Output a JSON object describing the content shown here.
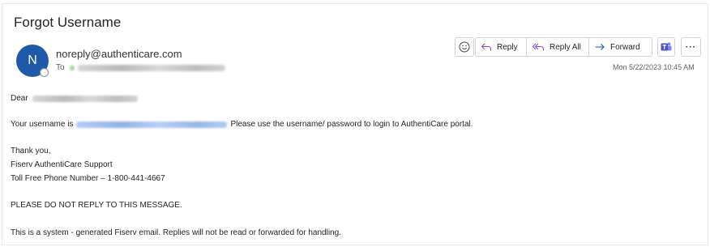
{
  "email": {
    "subject": "Forgot Username",
    "avatar_initial": "N",
    "sender": "noreply@authenticare.com",
    "to_label": "To",
    "date": "Mon 5/22/2023 10:45 AM"
  },
  "toolbar": {
    "emoji_icon": "smiley-icon",
    "reply_label": "Reply",
    "reply_all_label": "Reply All",
    "forward_label": "Forward",
    "teams_icon": "teams-icon",
    "more_label": "···"
  },
  "body": {
    "greeting": "Dear",
    "username_prefix": "Your username is",
    "username_suffix": "Please use the username/ password to login to AuthentiCare portal.",
    "thanks": "Thank you,",
    "support_name": "Fiserv AuthentiCare Support",
    "phone_line": "Toll Free Phone Number – 1-800-441-4667",
    "do_not_reply": "PLEASE DO NOT REPLY TO THIS MESSAGE.",
    "system_note": "This is a system - generated Fiserv email. Replies will not be read or forwarded for handling."
  },
  "colors": {
    "accent_purple": "#8a4fb5",
    "avatar_blue": "#1f5aa8",
    "teams_purple": "#4b53bc"
  }
}
